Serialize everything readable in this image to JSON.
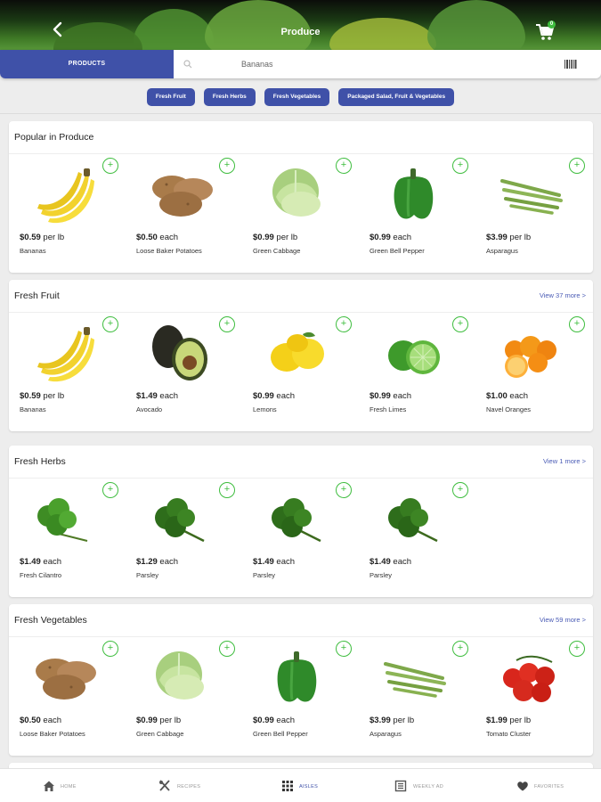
{
  "header": {
    "title": "Produce",
    "cart_count": "0"
  },
  "search": {
    "tab_label": "PRODUCTS",
    "value": "Bananas"
  },
  "chips": [
    "Fresh Fruit",
    "Fresh Herbs",
    "Fresh Vegetables",
    "Packaged Salad, Fruit & Vegetables"
  ],
  "colors": {
    "accent": "#3f51a8",
    "add": "#3ebd3e",
    "link": "#4a5bb5"
  },
  "sections": [
    {
      "title": "Popular in Produce",
      "view_more": "",
      "items": [
        {
          "price": "$0.59",
          "unit": "per lb",
          "name": "Bananas",
          "icon": "banana-icon"
        },
        {
          "price": "$0.50",
          "unit": "each",
          "name": "Loose Baker Potatoes",
          "icon": "potato-icon"
        },
        {
          "price": "$0.99",
          "unit": "per lb",
          "name": "Green Cabbage",
          "icon": "cabbage-icon"
        },
        {
          "price": "$0.99",
          "unit": "each",
          "name": "Green Bell Pepper",
          "icon": "pepper-icon"
        },
        {
          "price": "$3.99",
          "unit": "per lb",
          "name": "Asparagus",
          "icon": "asparagus-icon"
        }
      ]
    },
    {
      "title": "Fresh Fruit",
      "view_more": "View 37 more >",
      "items": [
        {
          "price": "$0.59",
          "unit": "per lb",
          "name": "Bananas",
          "icon": "banana-icon"
        },
        {
          "price": "$1.49",
          "unit": "each",
          "name": "Avocado",
          "icon": "avocado-icon"
        },
        {
          "price": "$0.99",
          "unit": "each",
          "name": "Lemons",
          "icon": "lemon-icon"
        },
        {
          "price": "$0.99",
          "unit": "each",
          "name": "Fresh Limes",
          "icon": "lime-icon"
        },
        {
          "price": "$1.00",
          "unit": "each",
          "name": "Navel Oranges",
          "icon": "orange-icon"
        }
      ]
    },
    {
      "title": "Fresh Herbs",
      "view_more": "View 1 more >",
      "items": [
        {
          "price": "$1.49",
          "unit": "each",
          "name": "Fresh Cilantro",
          "icon": "cilantro-icon"
        },
        {
          "price": "$1.29",
          "unit": "each",
          "name": "Parsley",
          "icon": "parsley-icon"
        },
        {
          "price": "$1.49",
          "unit": "each",
          "name": "Parsley",
          "icon": "parsley-icon"
        },
        {
          "price": "$1.49",
          "unit": "each",
          "name": "Parsley",
          "icon": "parsley-icon"
        }
      ]
    },
    {
      "title": "Fresh Vegetables",
      "view_more": "View 59 more >",
      "items": [
        {
          "price": "$0.50",
          "unit": "each",
          "name": "Loose Baker Potatoes",
          "icon": "potato-icon"
        },
        {
          "price": "$0.99",
          "unit": "per lb",
          "name": "Green Cabbage",
          "icon": "cabbage-icon"
        },
        {
          "price": "$0.99",
          "unit": "each",
          "name": "Green Bell Pepper",
          "icon": "pepper-icon"
        },
        {
          "price": "$3.99",
          "unit": "per lb",
          "name": "Asparagus",
          "icon": "asparagus-icon"
        },
        {
          "price": "$1.99",
          "unit": "per lb",
          "name": "Tomato Cluster",
          "icon": "tomato-icon"
        }
      ]
    }
  ],
  "bottom_nav": [
    {
      "label": "HOME",
      "icon": "home-icon",
      "active": false
    },
    {
      "label": "RECIPES",
      "icon": "utensils-icon",
      "active": false
    },
    {
      "label": "AISLES",
      "icon": "grid-icon",
      "active": true
    },
    {
      "label": "WEEKLY AD",
      "icon": "newspaper-icon",
      "active": false
    },
    {
      "label": "FAVORITES",
      "icon": "heart-icon",
      "active": false
    }
  ]
}
